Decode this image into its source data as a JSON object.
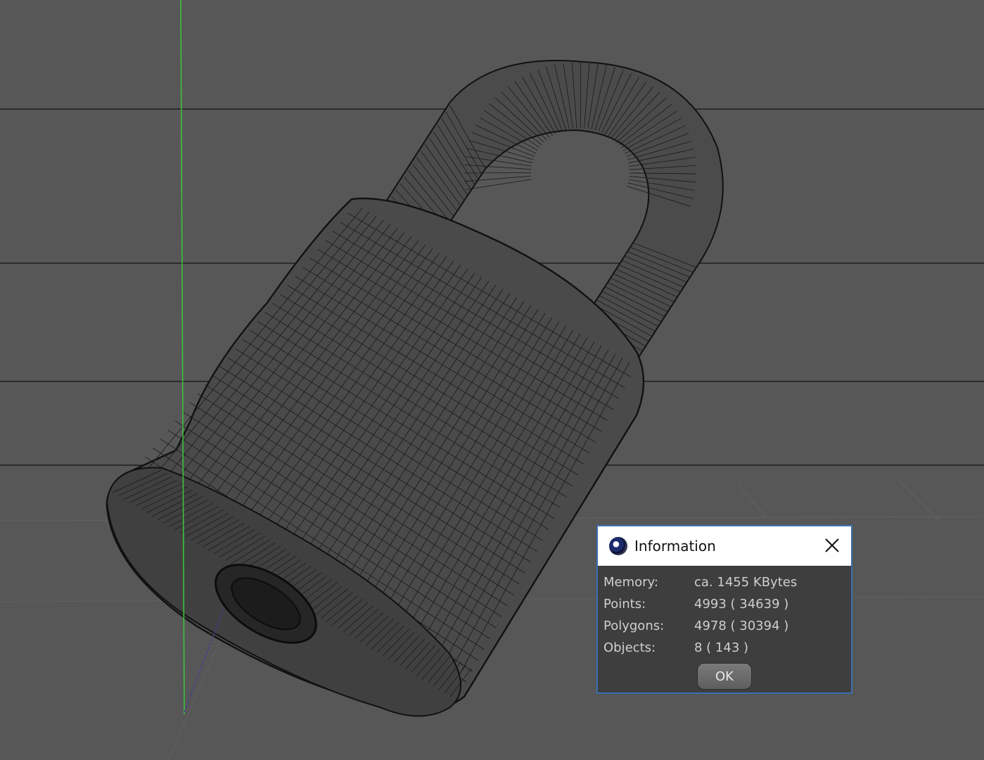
{
  "viewport": {
    "background": "#575757",
    "grid_line_color": "#1e1e1e",
    "y_axis_color": "#3cc23c",
    "z_axis_color": "#3a3aa8",
    "wire_color": "#111111",
    "fill_color": "#4b4b4b"
  },
  "dialog": {
    "title": "Information",
    "icon": "cinema4d-app-icon",
    "close_icon": "close-icon",
    "border_color": "#3b6fae",
    "rows": [
      {
        "label": "Memory:",
        "value": "ca. 1455 KBytes"
      },
      {
        "label": "Points:",
        "value": "4993 ( 34639 )"
      },
      {
        "label": "Polygons:",
        "value": "4978 ( 30394 )"
      },
      {
        "label": "Objects:",
        "value": "8 ( 143 )"
      }
    ],
    "ok_label": "OK"
  }
}
